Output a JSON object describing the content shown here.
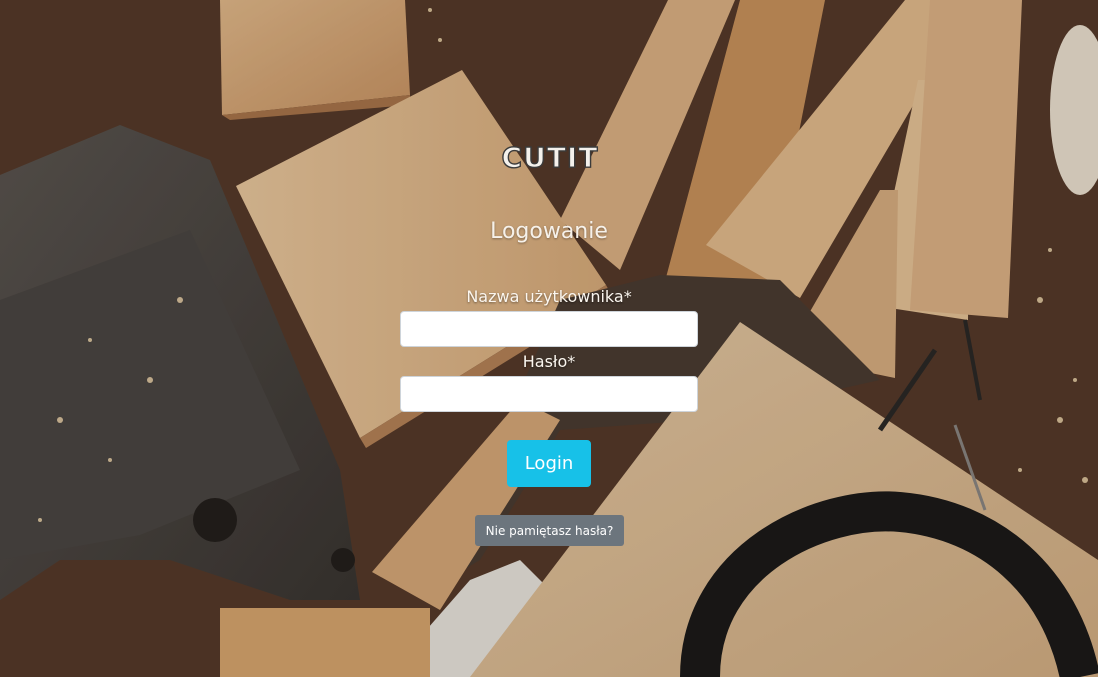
{
  "brand": {
    "logo_text": "CUTIT"
  },
  "login": {
    "heading": "Logowanie",
    "username_label": "Nazwa użytkownika*",
    "username_value": "",
    "password_label": "Hasło*",
    "password_value": "",
    "submit_label": "Login",
    "forgot_label": "Nie pamiętasz hasła?"
  },
  "colors": {
    "login_button": "#17c1e8",
    "forgot_button": "#6c757d",
    "text": "#f6f1ea"
  }
}
